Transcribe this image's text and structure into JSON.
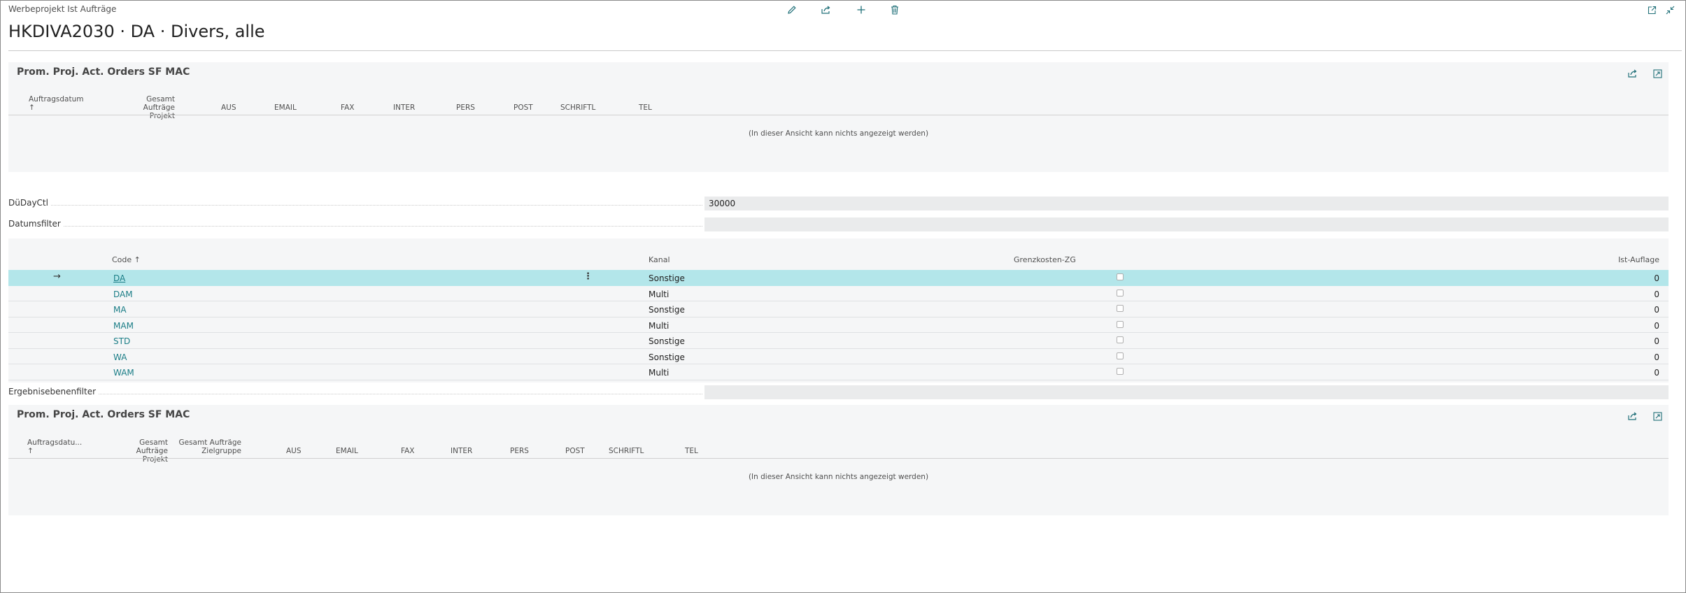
{
  "window": {
    "caption": "Werbeprojekt Ist Aufträge"
  },
  "toolbar": {
    "edit_icon": "pencil-icon",
    "share_icon": "share-icon",
    "new_icon": "plus-icon",
    "delete_icon": "trash-icon",
    "popout_icon": "popout-icon",
    "collapse_icon": "collapse-icon"
  },
  "page": {
    "title": "HKDIVA2030 · DA · Divers, alle"
  },
  "part1": {
    "title": "Prom. Proj. Act. Orders SF MAC",
    "columns": {
      "auftragsdatum": "Auftragsdatum",
      "sort_arrow": "↑",
      "gesamt_line1": "Gesamt Aufträge",
      "gesamt_line2": "Projekt",
      "aus": "AUS",
      "email": "EMAIL",
      "fax": "FAX",
      "inter": "INTER",
      "pers": "PERS",
      "post": "POST",
      "schriftl": "SCHRIFTL",
      "tel": "TEL"
    },
    "empty": "(In dieser Ansicht kann nichts angezeigt werden)"
  },
  "fields": {
    "dudayctl_label": "DüDayCtl",
    "dudayctl_value": "30000",
    "datumsfilter_label": "Datumsfilter",
    "datumsfilter_value": "",
    "ergebnis_label": "Ergebnisebenenfilter",
    "ergebnis_value": ""
  },
  "list": {
    "columns": {
      "code": "Code ↑",
      "kanal": "Kanal",
      "grenzkosten": "Grenzkosten-ZG",
      "ist_auflage": "Ist-Auflage"
    },
    "rows": [
      {
        "code": "DA",
        "kanal": "Sonstige",
        "ist": "0"
      },
      {
        "code": "DAM",
        "kanal": "Multi",
        "ist": "0"
      },
      {
        "code": "MA",
        "kanal": "Sonstige",
        "ist": "0"
      },
      {
        "code": "MAM",
        "kanal": "Multi",
        "ist": "0"
      },
      {
        "code": "STD",
        "kanal": "Sonstige",
        "ist": "0"
      },
      {
        "code": "WA",
        "kanal": "Sonstige",
        "ist": "0"
      },
      {
        "code": "WAM",
        "kanal": "Multi",
        "ist": "0"
      }
    ]
  },
  "part2": {
    "title": "Prom. Proj. Act. Orders SF MAC",
    "columns": {
      "auftragsdatum": "Auftragsdatu...",
      "sort_arrow": "↑",
      "gesamt_projekt_line1": "Gesamt Aufträge",
      "gesamt_projekt_line2": "Projekt",
      "gesamt_ziel_line1": "Gesamt Aufträge",
      "gesamt_ziel_line2": "Zielgruppe",
      "aus": "AUS",
      "email": "EMAIL",
      "fax": "FAX",
      "inter": "INTER",
      "pers": "PERS",
      "post": "POST",
      "schriftl": "SCHRIFTL",
      "tel": "TEL"
    },
    "empty": "(In dieser Ansicht kann nichts angezeigt werden)"
  },
  "colors": {
    "accent": "#1a7d86",
    "selected_row": "#b3e6ea",
    "part_bg": "#f5f6f7"
  }
}
